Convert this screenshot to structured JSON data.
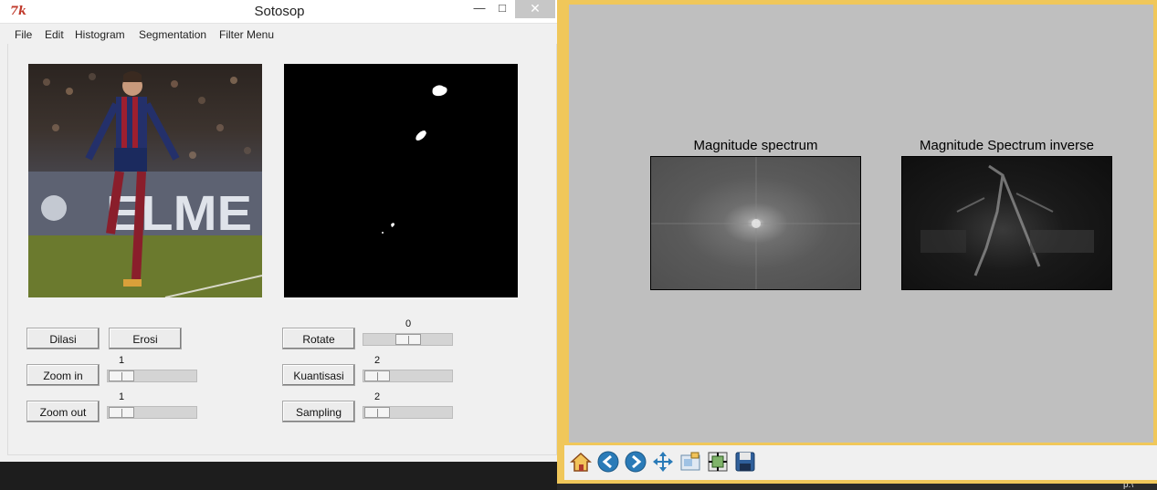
{
  "tk_window": {
    "title": "Sotosop",
    "logo_text": "7k",
    "controls": {
      "minimize": "—",
      "maximize": "□",
      "close": "✕"
    },
    "menu": [
      "File",
      "Edit",
      "Histogram",
      "Segmentation",
      "Filter Menu"
    ],
    "buttons": {
      "dilasi": "Dilasi",
      "erosi": "Erosi",
      "zoom_in": "Zoom in",
      "zoom_out": "Zoom out",
      "rotate": "Rotate",
      "kuantisasi": "Kuantisasi",
      "sampling": "Sampling"
    },
    "scales": {
      "zoom_in": "1",
      "zoom_out": "1",
      "rotate": "0",
      "kuantisasi": "2",
      "sampling": "2"
    },
    "photo_banner_text": "ELME"
  },
  "mpl_window": {
    "plots": [
      {
        "title": "Magnitude spectrum"
      },
      {
        "title": "Magnitude Spectrum inverse"
      }
    ],
    "toolbar_icons": [
      "home-icon",
      "back-icon",
      "forward-icon",
      "pan-icon",
      "zoom-icon",
      "configure-subplots-icon",
      "save-icon"
    ]
  },
  "tray": {
    "text": "p:\\"
  },
  "colors": {
    "canvas_bg": "#bfbfbf",
    "window_border": "#f0c75a"
  }
}
